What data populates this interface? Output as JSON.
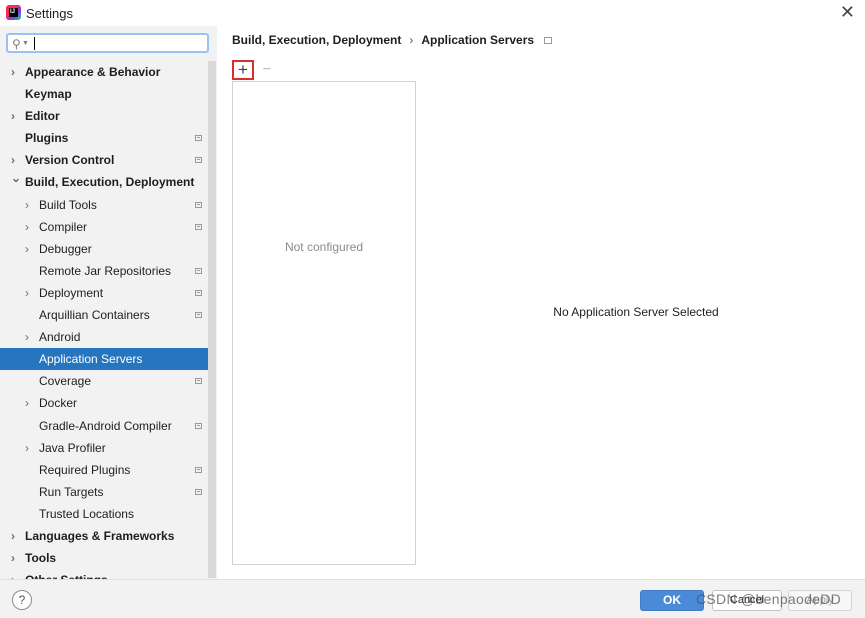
{
  "window": {
    "title": "Settings",
    "close_glyph": "✕"
  },
  "search": {
    "value": "",
    "placeholder": ""
  },
  "sidebar": {
    "items": [
      {
        "label": "Appearance & Behavior",
        "level": 0,
        "bold": true,
        "expandable": true,
        "expanded": false,
        "project_icon": false
      },
      {
        "label": "Keymap",
        "level": 0,
        "bold": true,
        "expandable": false,
        "project_icon": false
      },
      {
        "label": "Editor",
        "level": 0,
        "bold": true,
        "expandable": true,
        "expanded": false,
        "project_icon": false
      },
      {
        "label": "Plugins",
        "level": 0,
        "bold": true,
        "expandable": false,
        "project_icon": true
      },
      {
        "label": "Version Control",
        "level": 0,
        "bold": true,
        "expandable": true,
        "expanded": false,
        "project_icon": true
      },
      {
        "label": "Build, Execution, Deployment",
        "level": 0,
        "bold": true,
        "expandable": true,
        "expanded": true,
        "project_icon": false
      },
      {
        "label": "Build Tools",
        "level": 1,
        "bold": false,
        "expandable": true,
        "expanded": false,
        "project_icon": true
      },
      {
        "label": "Compiler",
        "level": 1,
        "bold": false,
        "expandable": true,
        "expanded": false,
        "project_icon": true
      },
      {
        "label": "Debugger",
        "level": 1,
        "bold": false,
        "expandable": true,
        "expanded": false,
        "project_icon": false
      },
      {
        "label": "Remote Jar Repositories",
        "level": 1,
        "bold": false,
        "expandable": false,
        "project_icon": true
      },
      {
        "label": "Deployment",
        "level": 1,
        "bold": false,
        "expandable": true,
        "expanded": false,
        "project_icon": true
      },
      {
        "label": "Arquillian Containers",
        "level": 1,
        "bold": false,
        "expandable": false,
        "project_icon": true
      },
      {
        "label": "Android",
        "level": 1,
        "bold": false,
        "expandable": true,
        "expanded": false,
        "project_icon": false
      },
      {
        "label": "Application Servers",
        "level": 1,
        "bold": false,
        "expandable": false,
        "project_icon": false,
        "selected": true
      },
      {
        "label": "Coverage",
        "level": 1,
        "bold": false,
        "expandable": false,
        "project_icon": true
      },
      {
        "label": "Docker",
        "level": 1,
        "bold": false,
        "expandable": true,
        "expanded": false,
        "project_icon": false
      },
      {
        "label": "Gradle-Android Compiler",
        "level": 1,
        "bold": false,
        "expandable": false,
        "project_icon": true
      },
      {
        "label": "Java Profiler",
        "level": 1,
        "bold": false,
        "expandable": true,
        "expanded": false,
        "project_icon": false
      },
      {
        "label": "Required Plugins",
        "level": 1,
        "bold": false,
        "expandable": false,
        "project_icon": true
      },
      {
        "label": "Run Targets",
        "level": 1,
        "bold": false,
        "expandable": false,
        "project_icon": true
      },
      {
        "label": "Trusted Locations",
        "level": 1,
        "bold": false,
        "expandable": false,
        "project_icon": false
      },
      {
        "label": "Languages & Frameworks",
        "level": 0,
        "bold": true,
        "expandable": true,
        "expanded": false,
        "project_icon": false
      },
      {
        "label": "Tools",
        "level": 0,
        "bold": true,
        "expandable": true,
        "expanded": false,
        "project_icon": false
      },
      {
        "label": "Other Settings",
        "level": 0,
        "bold": true,
        "expandable": true,
        "expanded": false,
        "project_icon": false
      }
    ]
  },
  "breadcrumb": {
    "parent": "Build, Execution, Deployment",
    "separator": "›",
    "current": "Application Servers"
  },
  "toolbar": {
    "add_glyph": "+",
    "remove_glyph": "−"
  },
  "server_list": {
    "empty_text": "Not configured"
  },
  "detail": {
    "empty_text": "No Application Server Selected"
  },
  "buttons": {
    "help": "?",
    "ok": "OK",
    "cancel": "Cancel",
    "apply": "Apply"
  },
  "watermark": "CSDN @benpaodeDD",
  "colors": {
    "selection": "#2675bf",
    "ok_button": "#4a8ad6",
    "sidebar_bg": "#f2f2f2",
    "highlight_border": "#e02b2b"
  }
}
